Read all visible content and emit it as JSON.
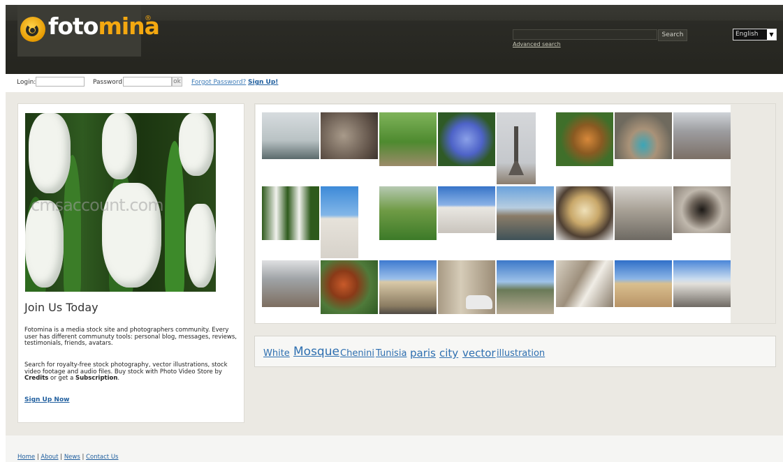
{
  "header": {
    "logo_text_white": "foto",
    "logo_text_orange": "mina",
    "logo_reg": "®",
    "search_placeholder": "",
    "search_button": "Search",
    "advanced_search": "Advanced search",
    "language": "English"
  },
  "login": {
    "login_label": "Login:",
    "password_label": "Password:",
    "ok_label": "ok",
    "forgot_label": "Forgot Password?",
    "signup_label": "Sign Up!"
  },
  "join": {
    "image_watermark": "cmsaccount.com",
    "title": "Join Us Today",
    "desc1": "Fotomina is a media stock site and photographers community. Every user has different communuty tools: personal blog, messages, reviews, testimonials, friends, avatars.",
    "desc2_pre": "Search for royalty-free stock photography, vector illustrations, stock video footage and audio files. Buy stock with Photo Video Store by ",
    "desc2_credits": "Credits",
    "desc2_mid": " or get a ",
    "desc2_subscription": "Subscription",
    "desc2_end": ".",
    "signup_now": "Sign Up Now"
  },
  "gallery": {
    "thumbs": [
      "city-skyline-water",
      "stone-relief",
      "green-park",
      "blue-flowers",
      "eiffel-tower",
      "tiger",
      "coliseum-pool",
      "paris-aerial",
      "white-hyacinth",
      "white-church",
      "spring-trees",
      "domed-building",
      "seine-river",
      "monkey",
      "street-buildings",
      "spiral-staircase",
      "city-panorama",
      "orangutan",
      "palace-facade",
      "paris-street-car",
      "park-square",
      "arch-stone",
      "minaret",
      "cathedral-domes"
    ]
  },
  "tags": [
    {
      "label": "White"
    },
    {
      "label": "Mosque"
    },
    {
      "label": "Chenini"
    },
    {
      "label": "Tunisia"
    },
    {
      "label": "paris"
    },
    {
      "label": "city"
    },
    {
      "label": "vector"
    },
    {
      "label": "illustration"
    }
  ],
  "footer": {
    "home": "Home",
    "about": "About",
    "news": "News",
    "contact": "Contact Us",
    "sep": "|"
  },
  "colors": {
    "accent": "#f4a810",
    "link": "#1f5e9e",
    "header_bg": "#2b2b26",
    "content_bg": "#ebe9e3"
  }
}
